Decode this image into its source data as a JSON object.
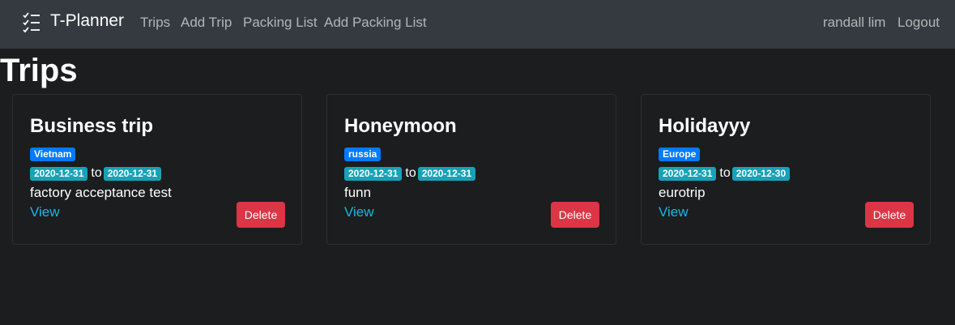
{
  "navbar": {
    "brand_icon": "checklist-icon",
    "brand": "T-Planner",
    "links": [
      "Trips",
      "Add Trip",
      "Packing List",
      "Add Packing List"
    ],
    "user": "randall lim",
    "logout": "Logout"
  },
  "page_title": "Trips",
  "colors": {
    "navbar_bg": "#343a40",
    "page_bg": "#1b1d1f",
    "badge_country": "#007bff",
    "badge_date": "#17a2b8",
    "link": "#17b8e8",
    "danger": "#dc3545"
  },
  "trips": [
    {
      "title": "Business trip",
      "country": "Vietnam",
      "start_date": "2020-12-31",
      "to_label": "to",
      "end_date": "2020-12-31",
      "description": "factory acceptance test",
      "view_label": "View",
      "delete_label": "Delete"
    },
    {
      "title": "Honeymoon",
      "country": "russia",
      "start_date": "2020-12-31",
      "to_label": "to",
      "end_date": "2020-12-31",
      "description": "funn",
      "view_label": "View",
      "delete_label": "Delete"
    },
    {
      "title": "Holidayyy",
      "country": "Europe",
      "start_date": "2020-12-31",
      "to_label": "to",
      "end_date": "2020-12-30",
      "description": "eurotrip",
      "view_label": "View",
      "delete_label": "Delete"
    }
  ]
}
